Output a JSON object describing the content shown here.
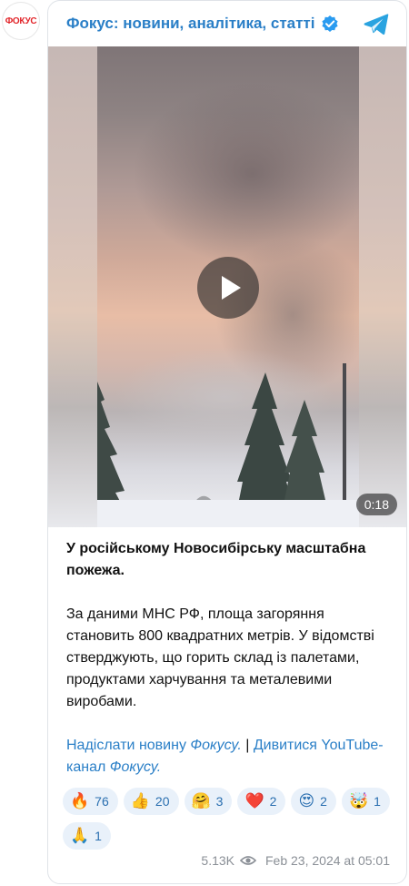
{
  "avatar": {
    "text": "ФОКУС"
  },
  "header": {
    "channel_name": "Фокус: новини, аналітика, статті",
    "verified_icon": "verified-badge-icon",
    "telegram_icon": "telegram-logo-icon"
  },
  "media": {
    "type": "video",
    "duration": "0:18",
    "play_icon": "play-icon"
  },
  "post": {
    "headline": "У російському Новосибірську масштабна пожежа.",
    "body": "За даними МНС РФ, площа загоряння становить 800 квадратних метрів. У відомстві стверджують, що горить склад із палетами, продуктами харчування та металевими виробами.",
    "link1_text": "Надіслати новину ",
    "link1_name": "Фокусу.",
    "separator": " | ",
    "link2_text": "Дивитися YouTube-канал ",
    "link2_name": "Фокусу."
  },
  "reactions": [
    {
      "emoji": "🔥",
      "count": "76"
    },
    {
      "emoji": "👍",
      "count": "20"
    },
    {
      "emoji": "🤗",
      "count": "3"
    },
    {
      "emoji": "❤️",
      "count": "2"
    },
    {
      "emoji": "😍",
      "count": "2"
    },
    {
      "emoji": "🤯",
      "count": "1"
    },
    {
      "emoji": "🙏",
      "count": "1"
    }
  ],
  "meta": {
    "views": "5.13K",
    "views_icon": "eye-icon",
    "date": "Feb 23, 2024 at 05:01"
  },
  "colors": {
    "accent": "#2a7fc7",
    "avatar_text": "#e2262b",
    "reaction_bg": "#e9f1fa",
    "meta_text": "#8a8f96"
  }
}
